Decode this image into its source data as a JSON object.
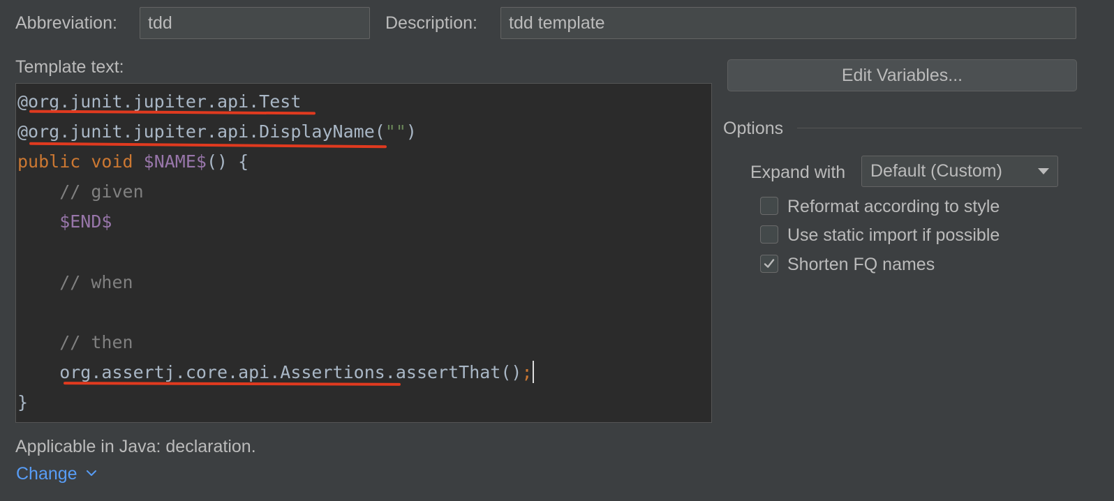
{
  "abbreviation": {
    "label": "Abbreviation:",
    "value": "tdd"
  },
  "description": {
    "label": "Description:",
    "value": "tdd template"
  },
  "template": {
    "label": "Template text:",
    "lines": [
      "@org.junit.jupiter.api.Test",
      "@org.junit.jupiter.api.DisplayName(\"\")",
      "public void $NAME$() {",
      "    // given",
      "    $END$",
      "",
      "    // when",
      "",
      "    // then",
      "    org.assertj.core.api.Assertions.assertThat();",
      "}"
    ]
  },
  "edit_variables_label": "Edit Variables...",
  "options": {
    "title": "Options",
    "expand_with_label": "Expand with",
    "expand_with_value": "Default (Custom)",
    "checkboxes": [
      {
        "label": "Reformat according to style",
        "checked": false
      },
      {
        "label": "Use static import if possible",
        "checked": false
      },
      {
        "label": "Shorten FQ names",
        "checked": true
      }
    ]
  },
  "applicable": {
    "text": "Applicable in Java: declaration.",
    "change_label": "Change"
  },
  "colors": {
    "background": "#3c3f41",
    "editor_background": "#2b2b2b",
    "keyword": "#cc7832",
    "template_variable": "#9876aa",
    "comment": "#808080",
    "string": "#6a8759",
    "annotation_underline": "#e03a1f",
    "link": "#589df6"
  }
}
